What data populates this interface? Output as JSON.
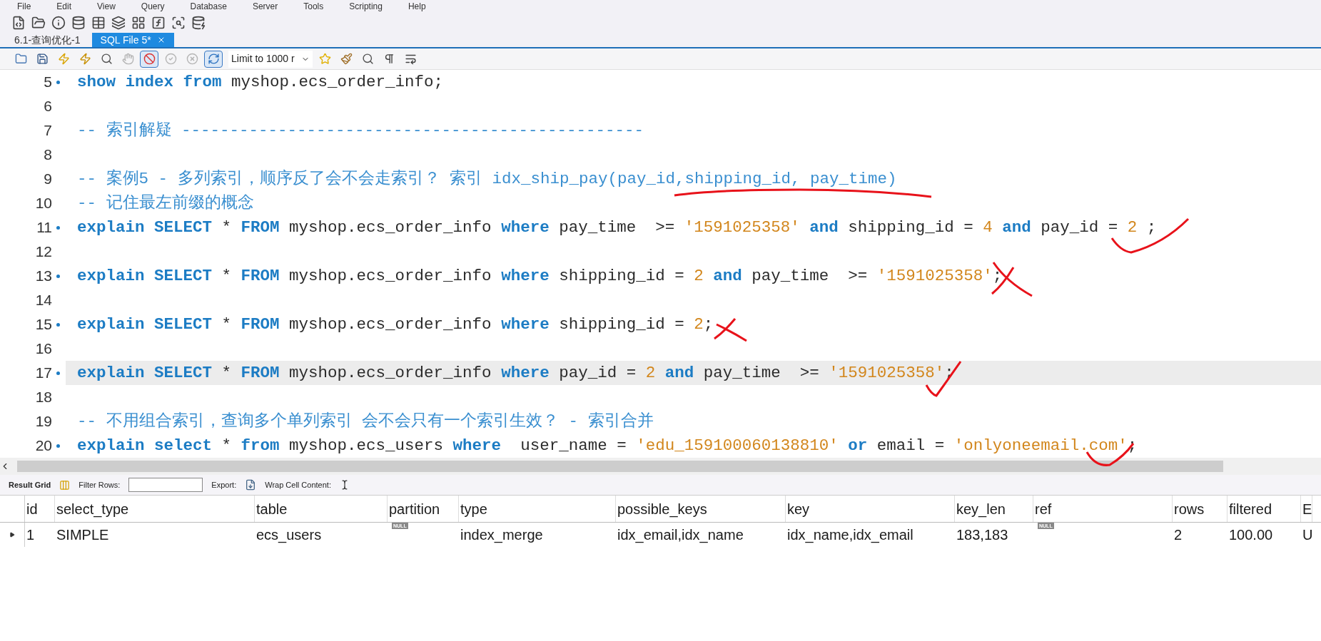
{
  "menu": [
    "File",
    "Edit",
    "View",
    "Query",
    "Database",
    "Server",
    "Tools",
    "Scripting",
    "Help"
  ],
  "tabs": [
    {
      "label": "6.1-查询优化-1",
      "selected": false,
      "closable": false
    },
    {
      "label": "SQL File 5*",
      "selected": true,
      "closable": true
    }
  ],
  "editor_toolbar": {
    "buttons": [
      {
        "kind": "open",
        "pressed": false,
        "disabled": false
      },
      {
        "kind": "save",
        "pressed": false,
        "disabled": false
      },
      {
        "kind": "execute",
        "pressed": false,
        "disabled": false
      },
      {
        "kind": "execute-current",
        "pressed": false,
        "disabled": false
      },
      {
        "kind": "explain",
        "pressed": false,
        "disabled": false
      },
      {
        "kind": "stop",
        "pressed": false,
        "disabled": true
      },
      {
        "kind": "stop-on-error",
        "pressed": true,
        "disabled": false
      },
      {
        "kind": "commit",
        "pressed": false,
        "disabled": true
      },
      {
        "kind": "rollback",
        "pressed": false,
        "disabled": true
      },
      {
        "kind": "autocommit",
        "pressed": true,
        "disabled": false
      }
    ],
    "limit": "Limit to 1000 r",
    "buttons_after": [
      {
        "kind": "snippet",
        "pressed": false,
        "disabled": false
      },
      {
        "kind": "beautify",
        "pressed": false,
        "disabled": false
      },
      {
        "kind": "find",
        "pressed": false,
        "disabled": false
      },
      {
        "kind": "invisibles",
        "pressed": false,
        "disabled": false
      },
      {
        "kind": "wrap",
        "pressed": false,
        "disabled": false
      }
    ]
  },
  "editor": {
    "lines": [
      {
        "number": "5",
        "statement": true,
        "current": false,
        "tokens": [
          {
            "kind": "keyword",
            "text": "show index from"
          },
          {
            "kind": "plain",
            "text": " myshop.ecs_order_info;"
          }
        ]
      },
      {
        "number": "6",
        "statement": false,
        "current": false
      },
      {
        "number": "7",
        "statement": false,
        "current": false,
        "tokens": [
          {
            "kind": "comment",
            "text": "-- 索引解疑 ------------------------------------------------"
          }
        ]
      },
      {
        "number": "8",
        "statement": false,
        "current": false
      },
      {
        "number": "9",
        "statement": false,
        "current": false,
        "tokens": [
          {
            "kind": "comment",
            "text": "-- 案例5 - 多列索引，顺序反了会不会走索引？ 索引 idx_ship_pay(pay_id,shipping_id, pay_time)"
          }
        ]
      },
      {
        "number": "10",
        "statement": false,
        "current": false,
        "tokens": [
          {
            "kind": "comment",
            "text": "-- 记住最左前缀的概念"
          }
        ]
      },
      {
        "number": "11",
        "statement": true,
        "current": false,
        "tokens": [
          {
            "kind": "keyword",
            "text": "explain SELECT"
          },
          {
            "kind": "plain",
            "text": " * "
          },
          {
            "kind": "keyword",
            "text": "FROM"
          },
          {
            "kind": "plain",
            "text": " myshop.ecs_order_info "
          },
          {
            "kind": "keyword",
            "text": "where"
          },
          {
            "kind": "plain",
            "text": " pay_time  >= "
          },
          {
            "kind": "string",
            "text": "'1591025358'"
          },
          {
            "kind": "keyword",
            "text": " and"
          },
          {
            "kind": "plain",
            "text": " shipping_id = "
          },
          {
            "kind": "number",
            "text": "4"
          },
          {
            "kind": "keyword",
            "text": " and"
          },
          {
            "kind": "plain",
            "text": " pay_id = "
          },
          {
            "kind": "number",
            "text": "2"
          },
          {
            "kind": "plain",
            "text": " ;"
          }
        ]
      },
      {
        "number": "12",
        "statement": false,
        "current": false
      },
      {
        "number": "13",
        "statement": true,
        "current": false,
        "tokens": [
          {
            "kind": "keyword",
            "text": "explain SELECT"
          },
          {
            "kind": "plain",
            "text": " * "
          },
          {
            "kind": "keyword",
            "text": "FROM"
          },
          {
            "kind": "plain",
            "text": " myshop.ecs_order_info "
          },
          {
            "kind": "keyword",
            "text": "where"
          },
          {
            "kind": "plain",
            "text": " shipping_id = "
          },
          {
            "kind": "number",
            "text": "2"
          },
          {
            "kind": "keyword",
            "text": " and"
          },
          {
            "kind": "plain",
            "text": " pay_time  >= "
          },
          {
            "kind": "string",
            "text": "'1591025358'"
          },
          {
            "kind": "plain",
            "text": ";"
          }
        ]
      },
      {
        "number": "14",
        "statement": false,
        "current": false
      },
      {
        "number": "15",
        "statement": true,
        "current": false,
        "tokens": [
          {
            "kind": "keyword",
            "text": "explain SELECT"
          },
          {
            "kind": "plain",
            "text": " * "
          },
          {
            "kind": "keyword",
            "text": "FROM"
          },
          {
            "kind": "plain",
            "text": " myshop.ecs_order_info "
          },
          {
            "kind": "keyword",
            "text": "where"
          },
          {
            "kind": "plain",
            "text": " shipping_id = "
          },
          {
            "kind": "number",
            "text": "2"
          },
          {
            "kind": "plain",
            "text": ";"
          }
        ]
      },
      {
        "number": "16",
        "statement": false,
        "current": false
      },
      {
        "number": "17",
        "statement": true,
        "current": true,
        "tokens": [
          {
            "kind": "keyword",
            "text": "explain SELECT"
          },
          {
            "kind": "plain",
            "text": " * "
          },
          {
            "kind": "keyword",
            "text": "FROM"
          },
          {
            "kind": "plain",
            "text": " myshop.ecs_order_info "
          },
          {
            "kind": "keyword",
            "text": "where"
          },
          {
            "kind": "plain",
            "text": " pay_id = "
          },
          {
            "kind": "number",
            "text": "2"
          },
          {
            "kind": "keyword",
            "text": " and"
          },
          {
            "kind": "plain",
            "text": " pay_time  >= "
          },
          {
            "kind": "string",
            "text": "'1591025358'"
          },
          {
            "kind": "plain",
            "text": ";"
          }
        ]
      },
      {
        "number": "18",
        "statement": false,
        "current": false
      },
      {
        "number": "19",
        "statement": false,
        "current": false,
        "tokens": [
          {
            "kind": "comment",
            "text": "-- 不用组合索引，查询多个单列索引 会不会只有一个索引生效？ - 索引合并"
          }
        ]
      },
      {
        "number": "20",
        "statement": true,
        "current": false,
        "tokens": [
          {
            "kind": "keyword",
            "text": "explain select"
          },
          {
            "kind": "plain",
            "text": " * "
          },
          {
            "kind": "keyword",
            "text": "from"
          },
          {
            "kind": "plain",
            "text": " myshop.ecs_users "
          },
          {
            "kind": "keyword",
            "text": "where"
          },
          {
            "kind": "plain",
            "text": "  user_name = "
          },
          {
            "kind": "string",
            "text": "'edu_159100060138810'"
          },
          {
            "kind": "keyword",
            "text": " or"
          },
          {
            "kind": "plain",
            "text": " email = "
          },
          {
            "kind": "string",
            "text": "'onlyoneemail.com'"
          },
          {
            "kind": "plain",
            "text": ";"
          }
        ]
      }
    ]
  },
  "result_toolbar": {
    "result_grid": "Result Grid",
    "filter_label": "Filter Rows:",
    "export_label": "Export:",
    "wrap_label": "Wrap Cell Content:"
  },
  "result_grid": {
    "columns": [
      "id",
      "select_type",
      "table",
      "partition",
      "type",
      "possible_keys",
      "key",
      "key_len",
      "ref",
      "rows",
      "filtered",
      "E"
    ],
    "rows": [
      {
        "selected": true,
        "cells": [
          "1",
          "SIMPLE",
          "ecs_users",
          "NULL",
          "index_merge",
          "idx_email,idx_name",
          "idx_name,idx_email",
          "183,183",
          "NULL",
          "2",
          "100.00",
          "U"
        ]
      }
    ]
  }
}
